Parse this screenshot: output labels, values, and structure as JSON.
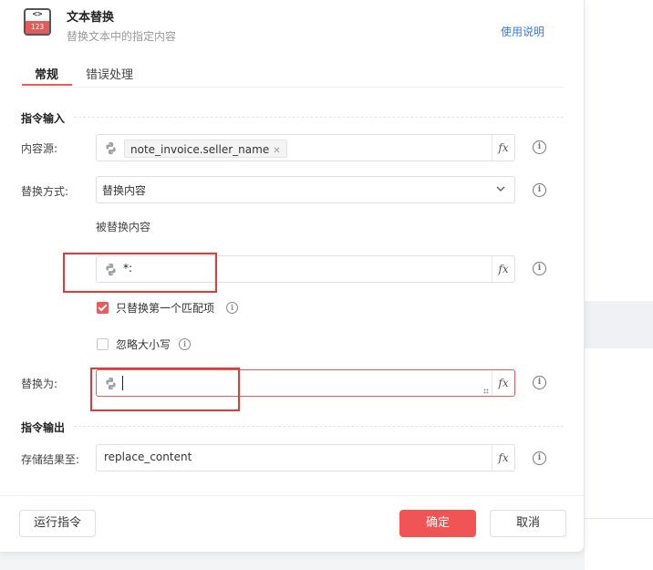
{
  "header": {
    "icon_code": "<>",
    "icon_number": "123",
    "title": "文本替换",
    "subtitle": "替换文本中的指定内容",
    "help_link": "使用说明"
  },
  "tabs": [
    {
      "label": "常规",
      "active": true
    },
    {
      "label": "错误处理",
      "active": false
    }
  ],
  "input_section": {
    "title": "指令输入",
    "content_source": {
      "label": "内容源:",
      "chip_value": "note_invoice.seller_name"
    },
    "replace_mode": {
      "label": "替换方式:",
      "selected": "替换内容"
    },
    "replaced_content": {
      "label": "被替换内容",
      "value": "*:"
    },
    "only_first_match": {
      "label": "只替换第一个匹配项",
      "checked": true
    },
    "ignore_case": {
      "label": "忽略大小写",
      "checked": false
    },
    "replace_with": {
      "label": "替换为:",
      "value": ""
    }
  },
  "output_section": {
    "title": "指令输出",
    "store_result": {
      "label": "存储结果至:",
      "value": "replace_content"
    }
  },
  "fx_label": "fx",
  "info_glyph": "i",
  "footer": {
    "run_button": "运行指令",
    "confirm_button": "确定",
    "cancel_button": "取消"
  },
  "colors": {
    "accent": "#f05454",
    "link": "#2f7df6",
    "highlight_box": "#e03a3a"
  }
}
